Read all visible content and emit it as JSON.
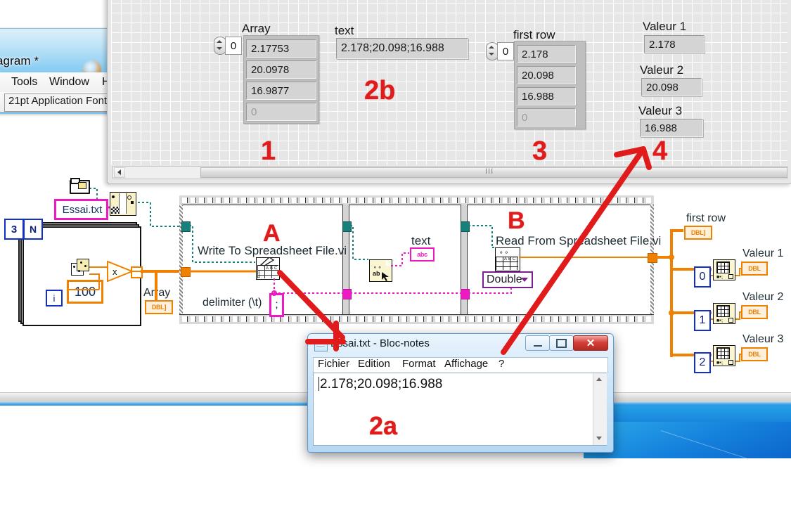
{
  "desktop": {
    "wallpaper_color": "#1581dc"
  },
  "labview_diagram_window": {
    "title": "agram *",
    "menus": [
      {
        "name": "tools",
        "label": "Tools"
      },
      {
        "name": "window",
        "label": "Window"
      },
      {
        "name": "help",
        "label": "H"
      }
    ],
    "font_selector": "21pt Application Font"
  },
  "front_panel": {
    "array_control": {
      "label": "Array",
      "index_value": "0",
      "cells": [
        "2.17753",
        "20.0978",
        "16.9877",
        "0"
      ]
    },
    "text_indicator": {
      "label": "text",
      "value": "2.178;20.098;16.988"
    },
    "first_row_control": {
      "label": "first row",
      "index_value": "0",
      "cells": [
        "2.178",
        "20.098",
        "16.988",
        "0"
      ]
    },
    "valeurs": [
      {
        "label": "Valeur 1",
        "value": "2.178"
      },
      {
        "label": "Valeur 2",
        "value": "20.098"
      },
      {
        "label": "Valeur 3",
        "value": "16.988"
      }
    ],
    "scroll_grip": "III"
  },
  "annotations": [
    {
      "name": "annotation-1",
      "text": "1"
    },
    {
      "name": "annotation-2b",
      "text": "2b"
    },
    {
      "name": "annotation-3",
      "text": "3"
    },
    {
      "name": "annotation-4",
      "text": "4"
    },
    {
      "name": "annotation-A",
      "text": "A"
    },
    {
      "name": "annotation-B",
      "text": "B"
    },
    {
      "name": "annotation-2a",
      "text": "2a"
    }
  ],
  "annotation_color": "#e01b1b",
  "block_diagram": {
    "file_path_constant": "Essai.txt",
    "loop_count_constant": "3",
    "loop_n_terminal": "N",
    "loop_i_terminal": "i",
    "multiplier_constant": "100",
    "array_terminal_label": "Array",
    "array_terminal_type": "DBL]",
    "write_vi_label": "Write To Spreadsheet File.vi",
    "delimiter_label": "delimiter (\\t)",
    "delimiter_value": ";",
    "text_terminal_label": "text",
    "text_terminal_type": "abc",
    "read_vi_label": "Read From Spreadsheet File.vi",
    "read_type_enum": "Double",
    "first_row_terminal_label": "first row",
    "first_row_terminal_type": "DBL]",
    "index_array_nodes": [
      {
        "index": "0",
        "label": "Valeur 1",
        "type": "DBL"
      },
      {
        "index": "1",
        "label": "Valeur 2",
        "type": "DBL"
      },
      {
        "index": "2",
        "label": "Valeur 3",
        "type": "DBL"
      }
    ]
  },
  "notepad": {
    "title": "Essai.txt - Bloc-notes",
    "menus": [
      {
        "name": "fichier",
        "label": "Fichier"
      },
      {
        "name": "edition",
        "label": "Edition"
      },
      {
        "name": "format",
        "label": "Format"
      },
      {
        "name": "affichage",
        "label": "Affichage"
      },
      {
        "name": "aide",
        "label": "?"
      }
    ],
    "content": "2.178;20.098;16.988",
    "close_label": "✕"
  }
}
